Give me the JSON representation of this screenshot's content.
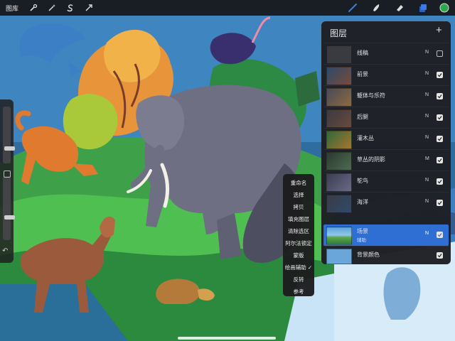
{
  "toolbar": {
    "gallery_label": "图库",
    "left_icons": [
      "wrench-icon",
      "magic-wand-icon",
      "selection-s-icon",
      "arrow-cursor-icon"
    ],
    "right_icons": [
      "brush-icon",
      "smudge-icon",
      "eraser-icon",
      "layers-icon",
      "color-icon"
    ],
    "active_color": "#2ea54f",
    "accent_color": "#3a7be8"
  },
  "side_bar": {
    "brush_size_level": 0.25,
    "opacity_level": 0.35
  },
  "context_menu": {
    "items": [
      "重命名",
      "选择",
      "拷贝",
      "填充图层",
      "清除选区",
      "阿尔法锁定",
      "蒙版",
      "绘画辅助",
      "反转",
      "参考"
    ],
    "checked_item": "绘画辅助",
    "check_mark": "✓"
  },
  "layers_panel": {
    "title": "图层",
    "add_symbol": "+",
    "layers": [
      {
        "name": "线稿",
        "mode": "N",
        "visible": false
      },
      {
        "name": "前景",
        "mode": "N",
        "visible": true
      },
      {
        "name": "躯体与乐符",
        "mode": "N",
        "visible": true
      },
      {
        "name": "后腿",
        "mode": "N",
        "visible": true
      },
      {
        "name": "灌木丛",
        "mode": "N",
        "visible": true
      },
      {
        "name": "草丛的阴影",
        "mode": "M",
        "visible": true
      },
      {
        "name": "鸵鸟",
        "mode": "N",
        "visible": true
      },
      {
        "name": "海洋",
        "mode": "N",
        "visible": true
      },
      {
        "name": "场景",
        "subtitle": "辅助",
        "mode": "N",
        "visible": true,
        "selected": true
      }
    ],
    "background": {
      "name": "背景颜色",
      "visible": true,
      "color": "#6aa6da"
    }
  }
}
